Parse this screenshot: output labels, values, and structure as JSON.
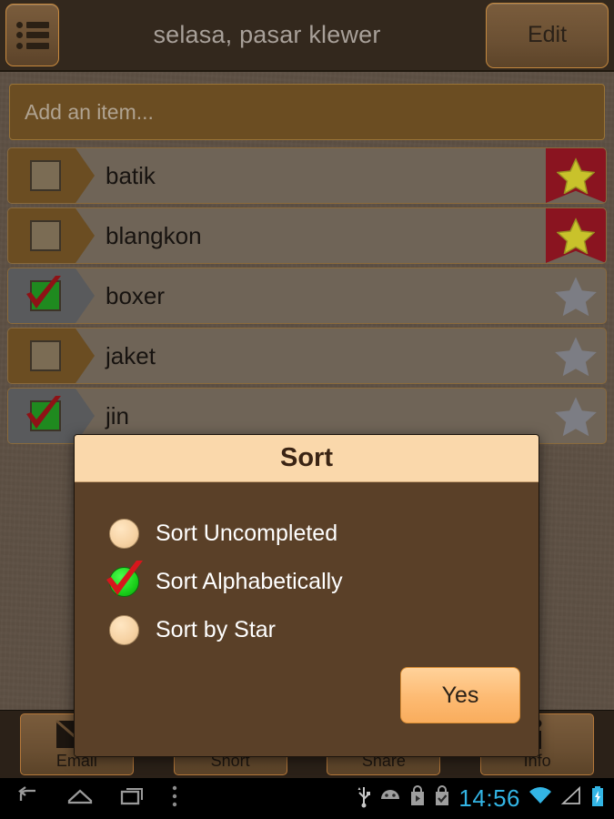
{
  "header": {
    "menu_icon": "list-menu-icon",
    "title": "selasa, pasar klewer",
    "edit_label": "Edit"
  },
  "add_item": {
    "placeholder": "Add an item...",
    "value": ""
  },
  "list": {
    "items": [
      {
        "label": "batik",
        "checked": false,
        "starred": true
      },
      {
        "label": "blangkon",
        "checked": false,
        "starred": true
      },
      {
        "label": "boxer",
        "checked": true,
        "starred": false
      },
      {
        "label": "jaket",
        "checked": false,
        "starred": false
      },
      {
        "label": "jin",
        "checked": true,
        "starred": false
      }
    ]
  },
  "dialog": {
    "title": "Sort",
    "options": [
      {
        "label": "Sort Uncompleted",
        "selected": false
      },
      {
        "label": "Sort Alphabetically",
        "selected": true
      },
      {
        "label": "Sort by Star",
        "selected": false
      }
    ],
    "confirm_label": "Yes"
  },
  "toolbar": {
    "buttons": [
      {
        "label": "Email",
        "icon": "envelope-icon"
      },
      {
        "label": "Short",
        "icon": "sort-az-icon"
      },
      {
        "label": "Share",
        "icon": "share-nodes-icon"
      },
      {
        "label": "Info",
        "icon": "info-icon"
      }
    ]
  },
  "navbar": {
    "back_icon": "back-arrow-icon",
    "home_icon": "home-icon",
    "recents_icon": "recent-apps-icon",
    "menu_icon": "overflow-menu-icon",
    "status_icons": [
      "usb-icon",
      "android-debug-icon",
      "play-store-icon",
      "checked-bag-icon"
    ],
    "time": "14:56",
    "wifi_icon": "wifi-icon",
    "signal_icon": "signal-icon",
    "battery_icon": "battery-charging-icon"
  },
  "colors": {
    "page_bg": "#5d5044",
    "header_bg": "#33281d",
    "accent_brown": "#6b4d22",
    "dialog_header_bg": "#fad8ab",
    "dialog_body_bg": "#5a4028",
    "ribbon_red": "#8a1420",
    "star_yellow": "#c9c22b",
    "check_green": "#1f8a1f",
    "check_red": "#8e1216",
    "clock_blue": "#33b5e5"
  }
}
